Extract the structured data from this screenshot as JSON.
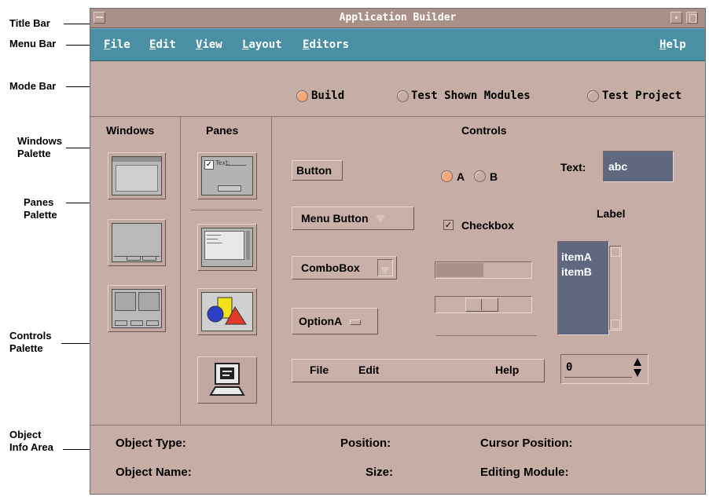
{
  "annotations": {
    "title_bar": "Title Bar",
    "menu_bar": "Menu Bar",
    "mode_bar": "Mode Bar",
    "windows_palette_1": "Windows",
    "windows_palette_2": "Palette",
    "panes_palette_1": "Panes",
    "panes_palette_2": "Palette",
    "controls_palette_1": "Controls",
    "controls_palette_2": "Palette",
    "object_info_1": "Object",
    "object_info_2": "Info Area"
  },
  "window": {
    "title": "Application Builder"
  },
  "menubar": {
    "items": [
      "File",
      "Edit",
      "View",
      "Layout",
      "Editors"
    ],
    "help": "Help"
  },
  "modebar": {
    "options": [
      "Build",
      "Test Shown Modules",
      "Test Project"
    ],
    "selected": "Build"
  },
  "palettes": {
    "windows_heading": "Windows",
    "panes_heading": "Panes",
    "controls_heading": "Controls"
  },
  "controls": {
    "button": "Button",
    "radio_a": "A",
    "radio_b": "B",
    "text_label": "Text:",
    "text_value": "abc",
    "menu_button": "Menu Button",
    "label": "Label",
    "checkbox": "Checkbox",
    "combobox": "ComboBox",
    "list_items": [
      "itemA",
      "itemB"
    ],
    "option": "OptionA",
    "menubar_items": [
      "File",
      "Edit",
      "Help"
    ],
    "spinbox_value": "0",
    "pane_text_sample": "Text:"
  },
  "info_area": {
    "object_type": "Object Type:",
    "object_name": "Object Name:",
    "position": "Position:",
    "size": "Size:",
    "cursor_position": "Cursor Position:",
    "editing_module": "Editing Module:"
  },
  "colors": {
    "body": "#c6ada5",
    "menubar": "#4a8fa3",
    "selected_radio": "#f4a878",
    "field": "#5f6880"
  }
}
